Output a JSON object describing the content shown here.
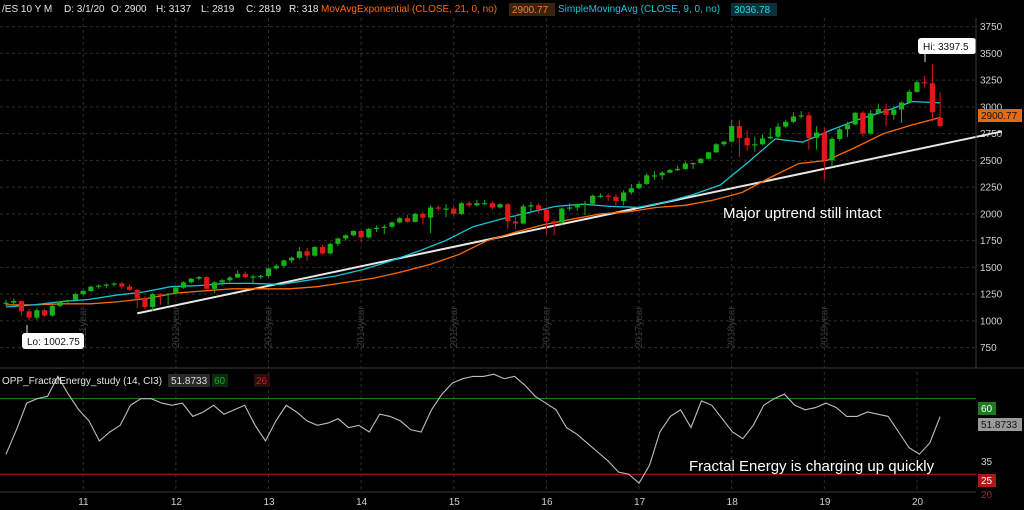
{
  "header": {
    "symbol": "/ES 10 Y M",
    "date": "D: 3/1/20",
    "open": "O: 2900",
    "high": "H: 3137",
    "low": "L: 2819",
    "close": "C: 2819",
    "range": "R: 318",
    "ema_label": "MovAvgExponential (CLOSE, 21, 0, no)",
    "ema_value": "2900.77",
    "sma_label": "SimpleMovingAvg (CLOSE, 9, 0, no)",
    "sma_value": "3036.78"
  },
  "annotations": {
    "hi": "Hi: 3397.5",
    "lo": "Lo: 1002.75",
    "uptrend": "Major uptrend still intact",
    "fractal": "Fractal Energy is charging up quickly"
  },
  "lower_header": {
    "study": "OPP_FractalEnergy_study (14, CI3)",
    "value": "51.8733",
    "upper_level": "60",
    "lower_level": "26"
  },
  "price_tag": "2900.77",
  "fe_tags": {
    "upper": "60",
    "value": "51.8733",
    "mid": "35",
    "lower": "25",
    "bottom": "20"
  },
  "colors": {
    "up": "#18b218",
    "down": "#e01818",
    "ema": "#ff6a00",
    "sma": "#19c3d6",
    "trendline": "#e8e8e8",
    "grid": "#2e2e2e",
    "fe_line": "#bdbdbd",
    "fe_upper": "#1c8a1c",
    "fe_lower": "#c01a1a"
  },
  "chart_data": [
    {
      "type": "candlestick",
      "title": "/ES 10 Y M",
      "y_ticks": [
        "3750",
        "3500",
        "3250",
        "3000",
        "2750",
        "2500",
        "2250",
        "2000",
        "1750",
        "1500",
        "1250",
        "1000",
        "750"
      ],
      "ylim": [
        560,
        3830
      ],
      "year_labels": [
        "2011year",
        "2012year",
        "2013year",
        "2014year",
        "2015year",
        "2016year",
        "2017year",
        "2018year",
        "2019year"
      ],
      "x_ticks": [
        "11",
        "12",
        "13",
        "14",
        "15",
        "16",
        "17",
        "18",
        "19",
        "20"
      ],
      "start_month": "2010-03",
      "candles": [
        {
          "o": 1160,
          "h": 1200,
          "l": 1140,
          "c": 1170
        },
        {
          "o": 1170,
          "h": 1210,
          "l": 1150,
          "c": 1185
        },
        {
          "o": 1185,
          "h": 1190,
          "l": 1050,
          "c": 1090
        },
        {
          "o": 1090,
          "h": 1110,
          "l": 1002.75,
          "c": 1030
        },
        {
          "o": 1030,
          "h": 1120,
          "l": 1010,
          "c": 1100
        },
        {
          "o": 1100,
          "h": 1110,
          "l": 1040,
          "c": 1050
        },
        {
          "o": 1050,
          "h": 1150,
          "l": 1040,
          "c": 1140
        },
        {
          "o": 1140,
          "h": 1190,
          "l": 1130,
          "c": 1180
        },
        {
          "o": 1180,
          "h": 1200,
          "l": 1170,
          "c": 1195
        },
        {
          "o": 1195,
          "h": 1260,
          "l": 1190,
          "c": 1250
        },
        {
          "o": 1250,
          "h": 1290,
          "l": 1240,
          "c": 1280
        },
        {
          "o": 1280,
          "h": 1330,
          "l": 1270,
          "c": 1320
        },
        {
          "o": 1320,
          "h": 1340,
          "l": 1300,
          "c": 1330
        },
        {
          "o": 1330,
          "h": 1350,
          "l": 1310,
          "c": 1340
        },
        {
          "o": 1340,
          "h": 1360,
          "l": 1320,
          "c": 1350
        },
        {
          "o": 1350,
          "h": 1360,
          "l": 1300,
          "c": 1320
        },
        {
          "o": 1320,
          "h": 1340,
          "l": 1280,
          "c": 1290
        },
        {
          "o": 1290,
          "h": 1300,
          "l": 1120,
          "c": 1210
        },
        {
          "o": 1210,
          "h": 1230,
          "l": 1110,
          "c": 1130
        },
        {
          "o": 1130,
          "h": 1260,
          "l": 1090,
          "c": 1250
        },
        {
          "o": 1250,
          "h": 1260,
          "l": 1150,
          "c": 1245
        },
        {
          "o": 1245,
          "h": 1260,
          "l": 1150,
          "c": 1255
        },
        {
          "o": 1255,
          "h": 1320,
          "l": 1250,
          "c": 1310
        },
        {
          "o": 1310,
          "h": 1370,
          "l": 1300,
          "c": 1360
        },
        {
          "o": 1360,
          "h": 1400,
          "l": 1350,
          "c": 1395
        },
        {
          "o": 1395,
          "h": 1420,
          "l": 1380,
          "c": 1410
        },
        {
          "o": 1410,
          "h": 1420,
          "l": 1290,
          "c": 1300
        },
        {
          "o": 1300,
          "h": 1370,
          "l": 1260,
          "c": 1360
        },
        {
          "o": 1360,
          "h": 1390,
          "l": 1330,
          "c": 1380
        },
        {
          "o": 1380,
          "h": 1420,
          "l": 1360,
          "c": 1405
        },
        {
          "o": 1405,
          "h": 1470,
          "l": 1400,
          "c": 1440
        },
        {
          "o": 1440,
          "h": 1460,
          "l": 1400,
          "c": 1410
        },
        {
          "o": 1410,
          "h": 1430,
          "l": 1340,
          "c": 1415
        },
        {
          "o": 1415,
          "h": 1430,
          "l": 1390,
          "c": 1420
        },
        {
          "o": 1420,
          "h": 1500,
          "l": 1410,
          "c": 1490
        },
        {
          "o": 1490,
          "h": 1530,
          "l": 1480,
          "c": 1515
        },
        {
          "o": 1515,
          "h": 1570,
          "l": 1500,
          "c": 1565
        },
        {
          "o": 1565,
          "h": 1600,
          "l": 1540,
          "c": 1590
        },
        {
          "o": 1590,
          "h": 1690,
          "l": 1580,
          "c": 1650
        },
        {
          "o": 1650,
          "h": 1680,
          "l": 1560,
          "c": 1610
        },
        {
          "o": 1610,
          "h": 1700,
          "l": 1600,
          "c": 1690
        },
        {
          "o": 1690,
          "h": 1710,
          "l": 1620,
          "c": 1630
        },
        {
          "o": 1630,
          "h": 1730,
          "l": 1620,
          "c": 1720
        },
        {
          "o": 1720,
          "h": 1780,
          "l": 1700,
          "c": 1770
        },
        {
          "o": 1770,
          "h": 1810,
          "l": 1750,
          "c": 1800
        },
        {
          "o": 1800,
          "h": 1850,
          "l": 1790,
          "c": 1840
        },
        {
          "o": 1840,
          "h": 1850,
          "l": 1740,
          "c": 1780
        },
        {
          "o": 1780,
          "h": 1870,
          "l": 1770,
          "c": 1860
        },
        {
          "o": 1860,
          "h": 1890,
          "l": 1830,
          "c": 1870
        },
        {
          "o": 1870,
          "h": 1900,
          "l": 1810,
          "c": 1880
        },
        {
          "o": 1880,
          "h": 1930,
          "l": 1870,
          "c": 1920
        },
        {
          "o": 1920,
          "h": 1970,
          "l": 1910,
          "c": 1960
        },
        {
          "o": 1960,
          "h": 1990,
          "l": 1920,
          "c": 1925
        },
        {
          "o": 1925,
          "h": 2010,
          "l": 1920,
          "c": 2000
        },
        {
          "o": 2000,
          "h": 2020,
          "l": 1900,
          "c": 1965
        },
        {
          "o": 1965,
          "h": 2080,
          "l": 1820,
          "c": 2060
        },
        {
          "o": 2060,
          "h": 2080,
          "l": 2030,
          "c": 2050
        },
        {
          "o": 2050,
          "h": 2090,
          "l": 1970,
          "c": 2050
        },
        {
          "o": 2050,
          "h": 2070,
          "l": 1980,
          "c": 2000
        },
        {
          "o": 2000,
          "h": 2110,
          "l": 1990,
          "c": 2100
        },
        {
          "o": 2100,
          "h": 2120,
          "l": 2060,
          "c": 2080
        },
        {
          "o": 2080,
          "h": 2130,
          "l": 2070,
          "c": 2100
        },
        {
          "o": 2100,
          "h": 2130,
          "l": 2080,
          "c": 2100
        },
        {
          "o": 2100,
          "h": 2120,
          "l": 2040,
          "c": 2060
        },
        {
          "o": 2060,
          "h": 2100,
          "l": 2050,
          "c": 2090
        },
        {
          "o": 2090,
          "h": 2100,
          "l": 1860,
          "c": 1930
        },
        {
          "o": 1930,
          "h": 1990,
          "l": 1860,
          "c": 1910
        },
        {
          "o": 1910,
          "h": 2090,
          "l": 1900,
          "c": 2070
        },
        {
          "o": 2070,
          "h": 2110,
          "l": 2020,
          "c": 2080
        },
        {
          "o": 2080,
          "h": 2100,
          "l": 2000,
          "c": 2040
        },
        {
          "o": 2040,
          "h": 2050,
          "l": 1810,
          "c": 1930
        },
        {
          "o": 1930,
          "h": 1950,
          "l": 1800,
          "c": 1920
        },
        {
          "o": 1920,
          "h": 2060,
          "l": 1900,
          "c": 2050
        },
        {
          "o": 2050,
          "h": 2100,
          "l": 2030,
          "c": 2060
        },
        {
          "o": 2060,
          "h": 2100,
          "l": 2030,
          "c": 2090
        },
        {
          "o": 2090,
          "h": 2120,
          "l": 1990,
          "c": 2095
        },
        {
          "o": 2095,
          "h": 2180,
          "l": 2080,
          "c": 2170
        },
        {
          "o": 2170,
          "h": 2190,
          "l": 2150,
          "c": 2170
        },
        {
          "o": 2170,
          "h": 2190,
          "l": 2120,
          "c": 2160
        },
        {
          "o": 2160,
          "h": 2180,
          "l": 2080,
          "c": 2120
        },
        {
          "o": 2120,
          "h": 2220,
          "l": 2080,
          "c": 2200
        },
        {
          "o": 2200,
          "h": 2280,
          "l": 2180,
          "c": 2240
        },
        {
          "o": 2240,
          "h": 2300,
          "l": 2230,
          "c": 2280
        },
        {
          "o": 2280,
          "h": 2380,
          "l": 2270,
          "c": 2360
        },
        {
          "o": 2360,
          "h": 2400,
          "l": 2320,
          "c": 2360
        },
        {
          "o": 2360,
          "h": 2400,
          "l": 2320,
          "c": 2385
        },
        {
          "o": 2385,
          "h": 2420,
          "l": 2380,
          "c": 2410
        },
        {
          "o": 2410,
          "h": 2450,
          "l": 2400,
          "c": 2420
        },
        {
          "o": 2420,
          "h": 2490,
          "l": 2410,
          "c": 2470
        },
        {
          "o": 2470,
          "h": 2480,
          "l": 2420,
          "c": 2475
        },
        {
          "o": 2475,
          "h": 2520,
          "l": 2470,
          "c": 2515
        },
        {
          "o": 2515,
          "h": 2580,
          "l": 2510,
          "c": 2575
        },
        {
          "o": 2575,
          "h": 2660,
          "l": 2570,
          "c": 2650
        },
        {
          "o": 2650,
          "h": 2680,
          "l": 2630,
          "c": 2675
        },
        {
          "o": 2675,
          "h": 2880,
          "l": 2670,
          "c": 2820
        },
        {
          "o": 2820,
          "h": 2880,
          "l": 2530,
          "c": 2710
        },
        {
          "o": 2710,
          "h": 2780,
          "l": 2590,
          "c": 2640
        },
        {
          "o": 2640,
          "h": 2720,
          "l": 2580,
          "c": 2650
        },
        {
          "o": 2650,
          "h": 2740,
          "l": 2640,
          "c": 2705
        },
        {
          "o": 2705,
          "h": 2800,
          "l": 2700,
          "c": 2720
        },
        {
          "o": 2720,
          "h": 2850,
          "l": 2700,
          "c": 2815
        },
        {
          "o": 2815,
          "h": 2880,
          "l": 2800,
          "c": 2860
        },
        {
          "o": 2860,
          "h": 2950,
          "l": 2850,
          "c": 2910
        },
        {
          "o": 2910,
          "h": 2960,
          "l": 2890,
          "c": 2920
        },
        {
          "o": 2920,
          "h": 2950,
          "l": 2600,
          "c": 2710
        },
        {
          "o": 2710,
          "h": 2820,
          "l": 2600,
          "c": 2760
        },
        {
          "o": 2760,
          "h": 2800,
          "l": 2320,
          "c": 2500
        },
        {
          "o": 2500,
          "h": 2720,
          "l": 2440,
          "c": 2700
        },
        {
          "o": 2700,
          "h": 2820,
          "l": 2680,
          "c": 2790
        },
        {
          "o": 2790,
          "h": 2860,
          "l": 2720,
          "c": 2835
        },
        {
          "o": 2835,
          "h": 2950,
          "l": 2830,
          "c": 2945
        },
        {
          "o": 2945,
          "h": 2960,
          "l": 2720,
          "c": 2750
        },
        {
          "o": 2750,
          "h": 2970,
          "l": 2740,
          "c": 2940
        },
        {
          "o": 2940,
          "h": 3030,
          "l": 2930,
          "c": 2980
        },
        {
          "o": 2980,
          "h": 3030,
          "l": 2820,
          "c": 2925
        },
        {
          "o": 2925,
          "h": 3010,
          "l": 2880,
          "c": 2975
        },
        {
          "o": 2975,
          "h": 3050,
          "l": 2850,
          "c": 3040
        },
        {
          "o": 3040,
          "h": 3160,
          "l": 3030,
          "c": 3140
        },
        {
          "o": 3140,
          "h": 3250,
          "l": 3130,
          "c": 3230
        },
        {
          "o": 3230,
          "h": 3290,
          "l": 3180,
          "c": 3220
        },
        {
          "o": 3220,
          "h": 3397.5,
          "l": 2860,
          "c": 2950
        },
        {
          "o": 2900,
          "h": 3137,
          "l": 2819,
          "c": 2819
        }
      ],
      "ema_21": [
        1150,
        1150,
        1160,
        1160,
        1180,
        1210,
        1260,
        1280,
        1300,
        1300,
        1300,
        1320,
        1360,
        1400,
        1460,
        1530,
        1620,
        1750,
        1830,
        1900,
        1950,
        2000,
        2020,
        2060,
        2080,
        2130,
        2200,
        2340,
        2470,
        2500,
        2620,
        2750,
        2830,
        2900.77
      ],
      "sma_9": [
        1130,
        1150,
        1180,
        1200,
        1240,
        1270,
        1320,
        1330,
        1350,
        1350,
        1340,
        1380,
        1420,
        1480,
        1560,
        1650,
        1750,
        1880,
        1950,
        2010,
        2070,
        2090,
        2070,
        2060,
        2110,
        2180,
        2270,
        2480,
        2700,
        2670,
        2780,
        2880,
        2960,
        3050,
        3036.78
      ],
      "trendline": [
        {
          "month": "2011-08",
          "y": 1070
        },
        {
          "month": "2020-12",
          "y": 2770
        }
      ],
      "hi": 3397.5,
      "lo": 1002.75
    },
    {
      "type": "line",
      "title": "OPP_FractalEnergy_study (14, CI3)",
      "y_levels": {
        "upper": 60,
        "lower": 26
      },
      "ylim": [
        18,
        72
      ],
      "x_ticks": [
        "11",
        "12",
        "13",
        "14",
        "15",
        "16",
        "17",
        "18",
        "19",
        "20"
      ],
      "values": [
        35,
        46,
        58,
        60,
        61,
        70,
        62,
        55,
        50,
        41,
        45,
        48,
        57,
        60,
        60,
        58,
        57,
        58,
        52,
        54,
        57,
        53,
        55,
        57,
        48,
        41,
        50,
        57,
        54,
        50,
        48,
        49,
        51,
        47,
        48,
        45,
        53,
        52,
        50,
        46,
        45,
        55,
        62,
        67,
        69,
        70,
        70,
        71,
        69,
        70,
        66,
        61,
        58,
        55,
        47,
        44,
        40,
        36,
        32,
        27,
        26,
        22,
        30,
        45,
        52,
        55,
        47,
        59,
        57,
        51,
        45,
        42,
        48,
        57,
        60,
        62,
        57,
        55,
        56,
        58,
        56,
        52,
        52,
        54,
        53,
        52,
        45,
        38,
        35,
        40,
        51.8733
      ],
      "value": 51.8733
    }
  ]
}
